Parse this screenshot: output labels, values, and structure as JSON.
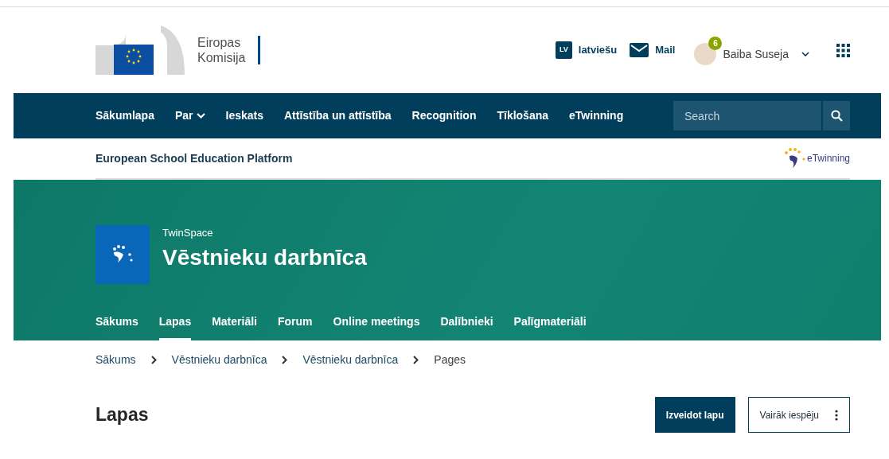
{
  "header": {
    "logo_lines": [
      "Eiropas",
      "Komisija"
    ],
    "language": {
      "code": "LV",
      "label": "latviešu"
    },
    "mail": "Mail",
    "user": {
      "name": "Baiba Suseja",
      "notifications": "6"
    }
  },
  "main_nav": {
    "items": [
      {
        "label": "Sākumlapa",
        "kind": "link"
      },
      {
        "label": "Par",
        "kind": "dropdown"
      },
      {
        "label": "Ieskats",
        "kind": "link"
      },
      {
        "label": "Attīstība un attīstība",
        "kind": "link"
      },
      {
        "label": "Recognition",
        "kind": "link"
      },
      {
        "label": "Tīklošana",
        "kind": "link"
      },
      {
        "label": "eTwinning",
        "kind": "link"
      }
    ],
    "search": {
      "placeholder": "Search"
    }
  },
  "platform_bar": {
    "title": "European School Education Platform",
    "logo_text": "eTwinning"
  },
  "twinspace": {
    "label": "TwinSpace",
    "title": "Vēstnieku darbnīca",
    "tabs": [
      {
        "label": "Sākums",
        "selected": false
      },
      {
        "label": "Lapas",
        "selected": true
      },
      {
        "label": "Materiāli",
        "selected": false
      },
      {
        "label": "Forum",
        "selected": false
      },
      {
        "label": "Online meetings",
        "selected": false
      },
      {
        "label": "Dalībnieki",
        "selected": false
      },
      {
        "label": "Palīgmateriāli",
        "selected": false
      }
    ]
  },
  "breadcrumb": [
    {
      "label": "Sākums",
      "current": false
    },
    {
      "label": "Vēstnieku darbnīca",
      "current": false
    },
    {
      "label": "Vēstnieku darbnīca",
      "current": false
    },
    {
      "label": "Pages",
      "current": true
    }
  ],
  "page": {
    "title": "Lapas",
    "buttons": [
      {
        "label": "Izveidot lapu",
        "kind": "primary"
      },
      {
        "label": "Vairāk iespēju",
        "kind": "more"
      }
    ]
  }
}
